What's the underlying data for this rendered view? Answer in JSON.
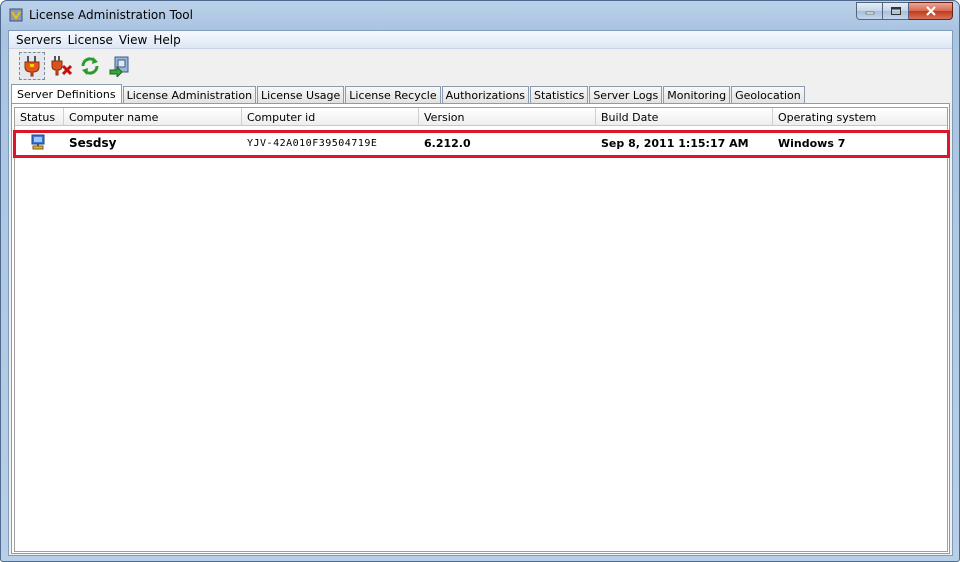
{
  "window": {
    "title": "License Administration Tool"
  },
  "menubar": {
    "items": [
      "Servers",
      "License",
      "View",
      "Help"
    ]
  },
  "toolbar": {
    "buttons": [
      {
        "icon": "connect-plug-icon"
      },
      {
        "icon": "disconnect-plug-icon"
      },
      {
        "icon": "refresh-icon"
      },
      {
        "icon": "export-server-icon"
      }
    ]
  },
  "tabs": [
    "Server Definitions",
    "License Administration",
    "License Usage",
    "License Recycle",
    "Authorizations",
    "Statistics",
    "Server Logs",
    "Monitoring",
    "Geolocation"
  ],
  "table": {
    "columns": [
      "Status",
      "Computer name",
      "Computer id",
      "Version",
      "Build Date",
      "Operating system"
    ],
    "rows": [
      {
        "status_icon": "server-computer-icon",
        "computer_name": "Sesdsy",
        "computer_id": "YJV-42A010F39504719E",
        "version": "6.212.0",
        "build_date": "Sep 8, 2011 1:15:17 AM",
        "os": "Windows 7"
      }
    ]
  },
  "colors": {
    "highlight": "#d9162b",
    "titlebar": "#bcd2ea"
  }
}
